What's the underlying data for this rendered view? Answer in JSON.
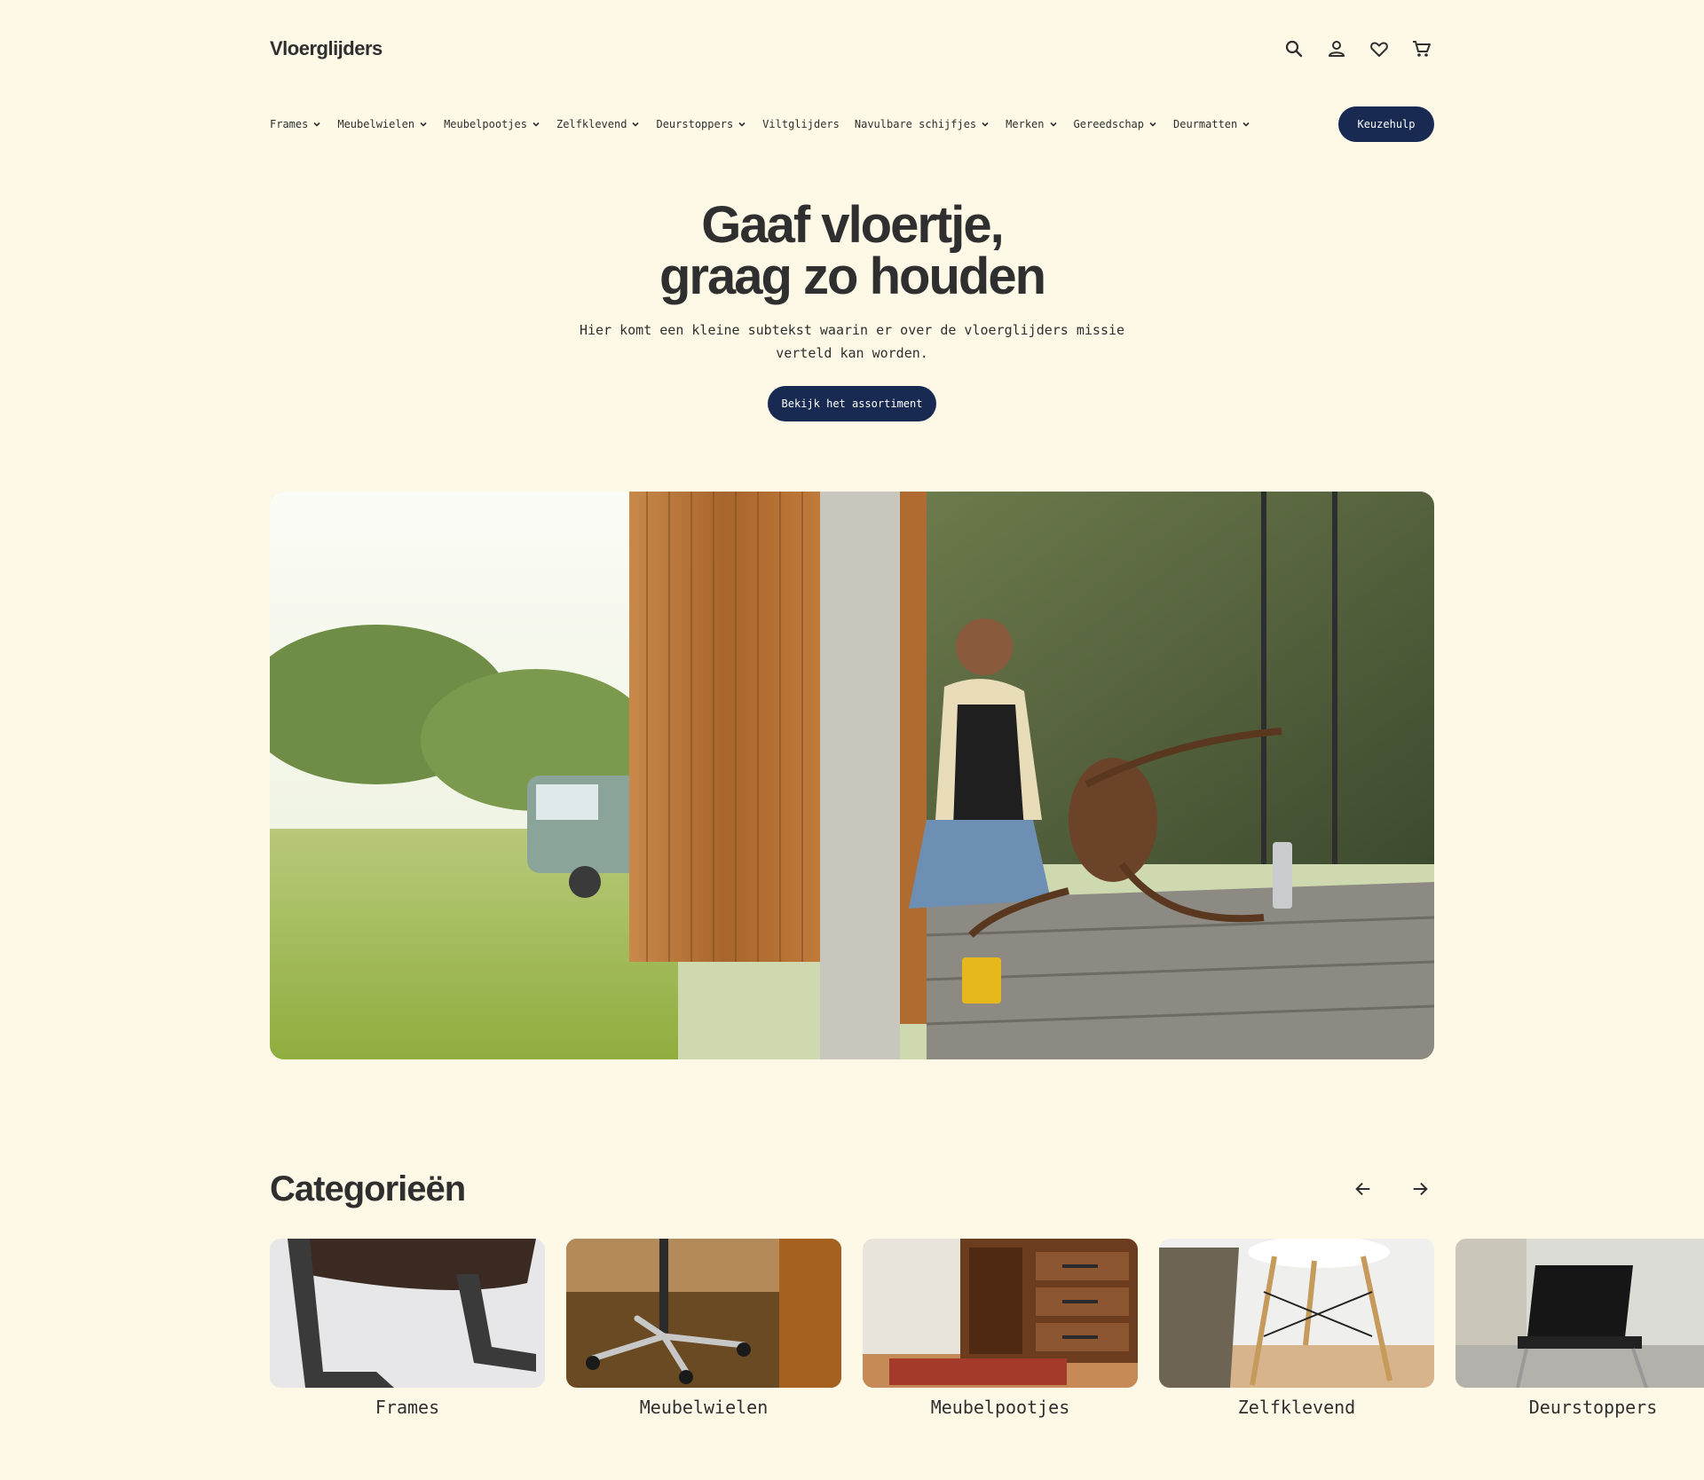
{
  "header": {
    "logo": "Vloerglijders",
    "icons": [
      "search-icon",
      "user-icon",
      "heart-icon",
      "cart-icon"
    ]
  },
  "nav": {
    "items": [
      {
        "label": "Frames",
        "dropdown": true
      },
      {
        "label": "Meubelwielen",
        "dropdown": true
      },
      {
        "label": "Meubelpootjes",
        "dropdown": true
      },
      {
        "label": "Zelfklevend",
        "dropdown": true
      },
      {
        "label": "Deurstoppers",
        "dropdown": true
      },
      {
        "label": "Viltglijders",
        "dropdown": false
      },
      {
        "label": "Navulbare schijfjes",
        "dropdown": true
      },
      {
        "label": "Merken",
        "dropdown": true
      },
      {
        "label": "Gereedschap",
        "dropdown": true
      },
      {
        "label": "Deurmatten",
        "dropdown": true
      }
    ],
    "cta_label": "Keuzehulp"
  },
  "hero": {
    "title_line1": "Gaaf vloertje,",
    "title_line2": "graag zo houden",
    "subtitle": "Hier komt een kleine subtekst waarin er over de vloerglijders missie verteld kan worden.",
    "cta_label": "Bekijk het assortiment"
  },
  "categories": {
    "title": "Categorieën",
    "items": [
      {
        "label": "Frames"
      },
      {
        "label": "Meubelwielen"
      },
      {
        "label": "Meubelpootjes"
      },
      {
        "label": "Zelfklevend"
      },
      {
        "label": "Deurstoppers"
      }
    ]
  },
  "colors": {
    "background": "#fef9e7",
    "primary": "#182a52",
    "text": "#2f2f2f"
  }
}
